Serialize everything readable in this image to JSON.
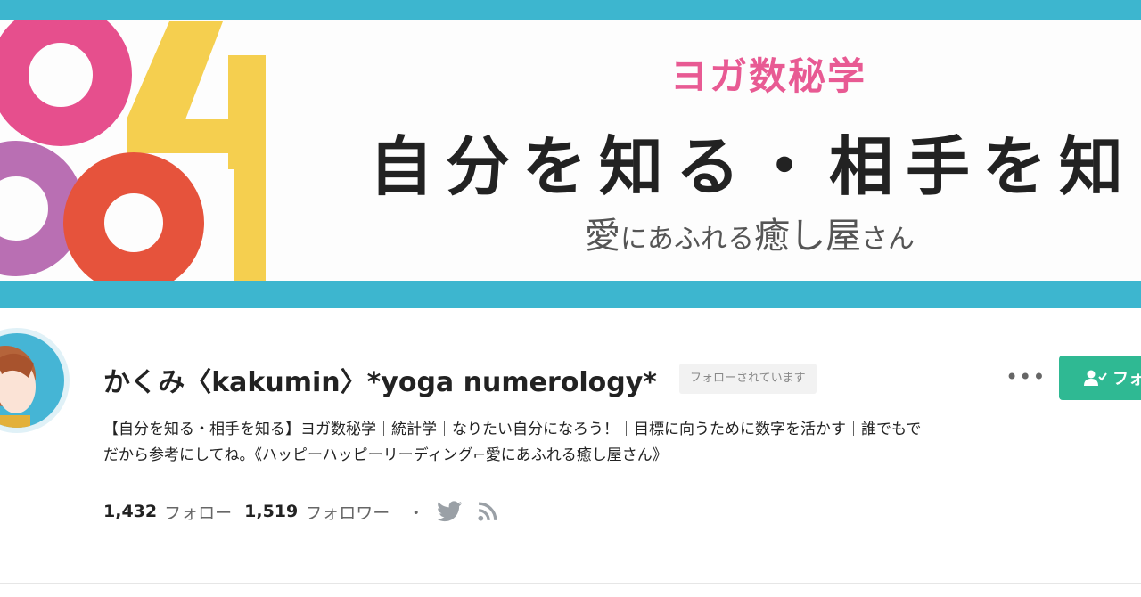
{
  "banner": {
    "subtitle": "ヨガ数秘学",
    "title": "自分を知る・相手を知",
    "tagline_part1": "愛",
    "tagline_part2": "にあふれる",
    "tagline_part3": "癒し屋",
    "tagline_part4": "さん",
    "art_digits": "0 4 8 0"
  },
  "profile": {
    "name": "かくみ〈kakumin〉*yoga numerology*",
    "follow_status": "フォローされています",
    "follow_button_label": "フォ",
    "bio_line1": "【自分を知る・相手を知る】ヨガ数秘学｜統計学｜なりたい自分になろう！｜目標に向うために数字を活かす｜誰でもで",
    "bio_line2": "だから参考にしてね。《ハッピーハッピーリーディング⌐愛にあふれる癒し屋さん》",
    "following_count": "1,432",
    "following_label": "フォロー",
    "followers_count": "1,519",
    "followers_label": "フォロワー",
    "separator": "・"
  },
  "icons": {
    "more": "more-dots-icon",
    "follow": "user-check-icon",
    "twitter": "twitter-icon",
    "rss": "rss-icon"
  },
  "colors": {
    "banner_frame": "#3db6cf",
    "subtitle_pink": "#e85a93",
    "follow_button": "#2fb993",
    "avatar_bg": "#45b5d5"
  }
}
